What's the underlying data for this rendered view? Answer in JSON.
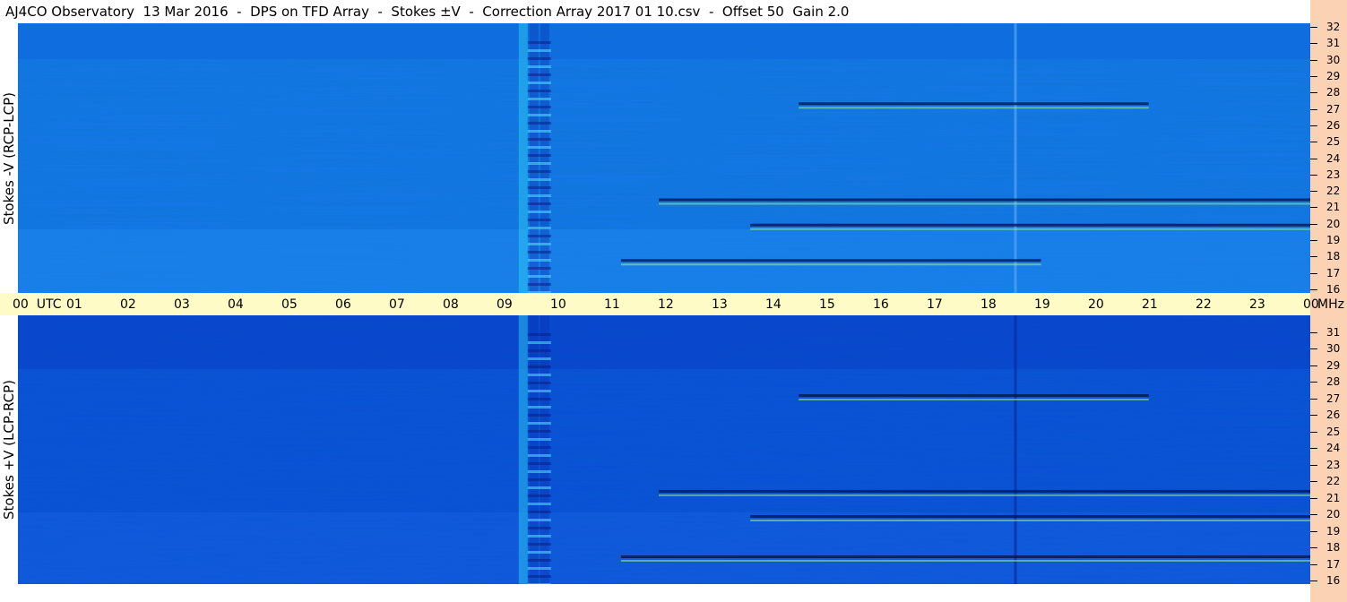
{
  "title": "AJ4CO Observatory  13 Mar 2016  -  DPS on TFD Array  -  Stokes ±V  -  Correction Array 2017 01 10.csv  -  Offset 50  Gain 2.0",
  "colors": {
    "upper_base": "#1577e8",
    "lower_base": "#0b4fd8",
    "time_axis_bg": "#fffbc6",
    "freq_axis_bg": "#fbd2b4"
  },
  "panels": [
    {
      "label": "Stokes -V (RCP-LCP)"
    },
    {
      "label": "Stokes +V (LCP-RCP)"
    }
  ],
  "time_axis": {
    "ticks": [
      "00  UTC",
      "01",
      "02",
      "03",
      "04",
      "05",
      "06",
      "07",
      "08",
      "09",
      "10",
      "11",
      "12",
      "13",
      "14",
      "15",
      "16",
      "17",
      "18",
      "19",
      "20",
      "21",
      "22",
      "23",
      "00"
    ],
    "unit": "MHz"
  },
  "freq_axis": {
    "labels": [
      "32",
      "31",
      "30",
      "29",
      "28",
      "27",
      "26",
      "25",
      "24",
      "23",
      "22",
      "21",
      "20",
      "19",
      "18",
      "17",
      "16"
    ]
  },
  "chart_data": [
    {
      "type": "heatmap",
      "title": "Stokes -V (RCP-LCP)",
      "x": {
        "label": "UTC",
        "range": [
          0,
          24
        ],
        "unit": "hours"
      },
      "y": {
        "range": [
          16,
          32
        ],
        "unit": "MHz"
      },
      "features": [
        {
          "kind": "vertical_burst",
          "utc": 9.6
        },
        {
          "kind": "vertical_line",
          "utc": 18.5
        },
        {
          "kind": "horizontal_band",
          "mhz": 17.9,
          "utc_range": [
            11.2,
            19.0
          ]
        },
        {
          "kind": "horizontal_band",
          "mhz": 21.5,
          "utc_range": [
            11.9,
            24.0
          ]
        },
        {
          "kind": "horizontal_band",
          "mhz": 20.0,
          "utc_range": [
            13.6,
            24.0
          ]
        },
        {
          "kind": "horizontal_band",
          "mhz": 27.2,
          "utc_range": [
            14.5,
            21.0
          ]
        }
      ]
    },
    {
      "type": "heatmap",
      "title": "Stokes +V (LCP-RCP)",
      "x": {
        "label": "UTC",
        "range": [
          0,
          24
        ],
        "unit": "hours"
      },
      "y": {
        "range": [
          16,
          32
        ],
        "unit": "MHz"
      },
      "features": [
        {
          "kind": "vertical_burst",
          "utc": 9.6
        },
        {
          "kind": "vertical_line",
          "utc": 18.5
        },
        {
          "kind": "horizontal_band",
          "mhz": 17.6,
          "utc_range": [
            11.2,
            24.0
          ]
        },
        {
          "kind": "horizontal_band",
          "mhz": 21.5,
          "utc_range": [
            11.9,
            24.0
          ]
        },
        {
          "kind": "horizontal_band",
          "mhz": 20.0,
          "utc_range": [
            13.6,
            24.0
          ]
        },
        {
          "kind": "horizontal_band",
          "mhz": 27.2,
          "utc_range": [
            14.5,
            21.0
          ]
        }
      ]
    }
  ]
}
